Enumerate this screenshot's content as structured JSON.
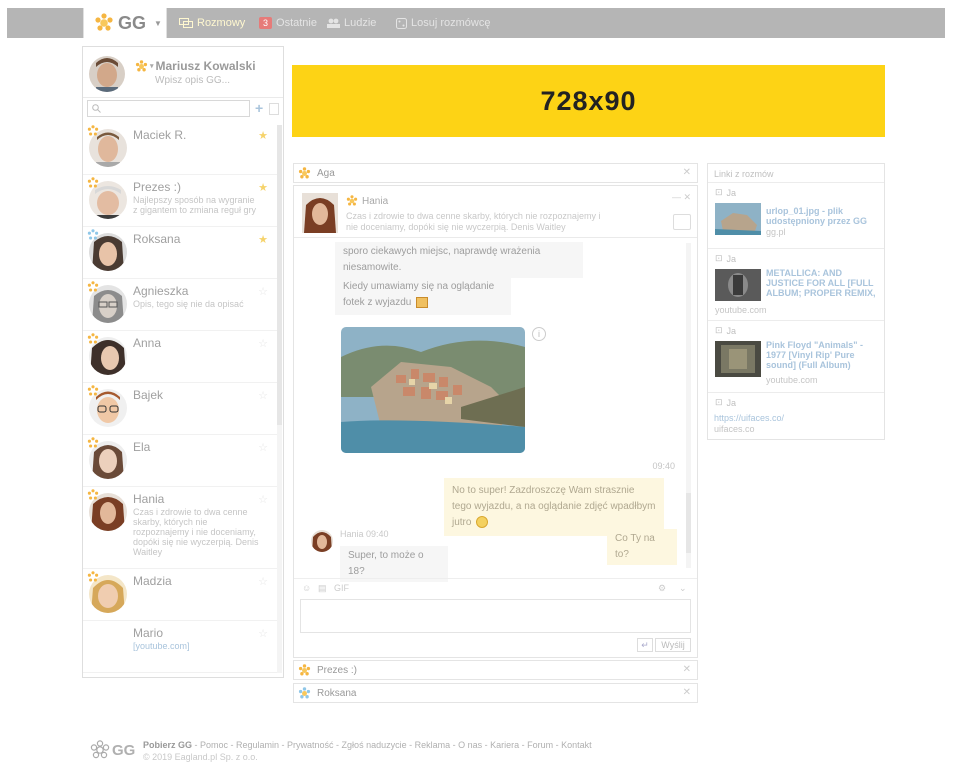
{
  "topbar": {
    "logo_text": "GG",
    "nav": [
      {
        "label": "Rozmowy",
        "active": true
      },
      {
        "label": "Ostatnie",
        "badge": "3"
      },
      {
        "label": "Ludzie"
      },
      {
        "label": "Losuj rozmówcę"
      }
    ]
  },
  "profile": {
    "name": "Mariusz Kowalski",
    "description": "Wpisz opis GG..."
  },
  "search": {
    "placeholder": ""
  },
  "contacts": [
    {
      "name": "Maciek R.",
      "desc": "",
      "star": true
    },
    {
      "name": "Prezes :)",
      "desc": "Najlepszy sposób na wygranie z gigantem to zmiana reguł gry",
      "star": true
    },
    {
      "name": "Roksana",
      "desc": "",
      "star": true
    },
    {
      "name": "Agnieszka",
      "desc": "Opis, tego się nie da opisać",
      "star": false
    },
    {
      "name": "Anna",
      "desc": "",
      "star": false
    },
    {
      "name": "Bajek",
      "desc": "",
      "star": false
    },
    {
      "name": "Ela",
      "desc": "",
      "star": false
    },
    {
      "name": "Hania",
      "desc": "Czas i zdrowie to dwa cenne skarby, których nie rozpoznajemy i nie doceniamy, dopóki się nie wyczerpią. Denis Waitley",
      "star": false
    },
    {
      "name": "Madzia",
      "desc": "",
      "star": false
    },
    {
      "name": "Mario",
      "desc": "[youtube.com]",
      "star": false
    }
  ],
  "ad": {
    "label": "728x90"
  },
  "chats": {
    "aga": "Aga",
    "prezes": "Prezes :)",
    "roksana": "Roksana"
  },
  "conversation": {
    "name": "Hania",
    "description": "Czas i zdrowie to dwa cenne skarby, których nie rozpoznajemy i nie doceniamy, dopóki się nie wyczerpią. Denis Waitley",
    "messages": {
      "m1": "sporo ciekawych miejsc, naprawdę wrażenia niesamowite.",
      "m2": "Kiedy umawiamy się na oglądanie fotek z wyjazdu",
      "time1": "09:40",
      "m3": "No to super! Zazdroszczę Wam strasznie tego wyjazdu, a na oglądanie zdjęć wpadłbym jutro",
      "m4": "Co Ty na to?",
      "meta": "Hania 09:40",
      "m5": "Super, to może o 18?"
    },
    "send_label": "Wyślij",
    "tools_label": "GIF"
  },
  "links": {
    "header": "Linki z rozmów",
    "author": "Ja",
    "items": [
      {
        "title": "urlop_01.jpg - plik udostępniony przez GG",
        "domain": "gg.pl"
      },
      {
        "title": "METALLICA: AND JUSTICE FOR ALL [FULL ALBUM; PROPER REMIX,",
        "domain": "youtube.com"
      },
      {
        "title": "Pink Floyd \"Animals\" - 1977 [Vinyl Rip' Pure sound] (Full Album)",
        "domain": "youtube.com"
      },
      {
        "title": "https://uifaces.co/",
        "domain": "uifaces.co"
      }
    ]
  },
  "footer": {
    "logo": "GG",
    "first": "Pobierz GG",
    "links": " - Pomoc - Regulamin - Prywatność - Zgłoś naduzycie - Reklama - O nas - Kariera - Forum - Kontakt",
    "copyright": "© 2019 Eagland.pl Sp. z o.o."
  },
  "colors": {
    "accent": "#fdd315",
    "topbar": "#b5b5b5",
    "link": "#a9c4dc"
  }
}
